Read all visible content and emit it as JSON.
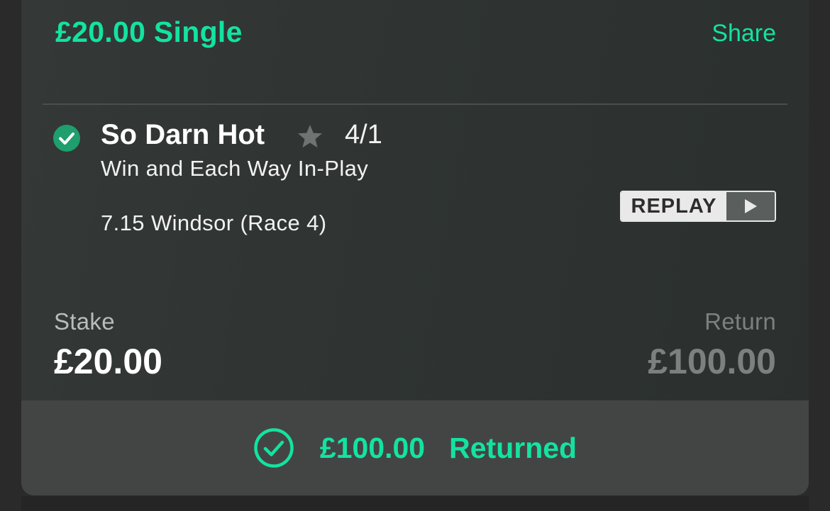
{
  "bet": {
    "title": "£20.00 Single",
    "share_label": "Share"
  },
  "selection": {
    "status_icon": "check-circle-icon",
    "runner_name": "So Darn Hot",
    "favourite_icon": "star-icon",
    "odds": "4/1",
    "market": "Win and Each Way In-Play",
    "event": "7.15 Windsor (Race 4)",
    "replay_label": "REPLAY",
    "replay_icon": "play-icon"
  },
  "summary": {
    "stake_label": "Stake",
    "stake_value": "£20.00",
    "return_label": "Return",
    "return_value": "£100.00"
  },
  "footer": {
    "icon": "check-circle-outline-icon",
    "amount": "£100.00",
    "status": "Returned"
  },
  "colors": {
    "accent": "#13e3a0",
    "check_fill": "#1f9e6e",
    "card_bg": "#313533",
    "footer_bg": "#434544",
    "muted_text": "#7c807e"
  }
}
